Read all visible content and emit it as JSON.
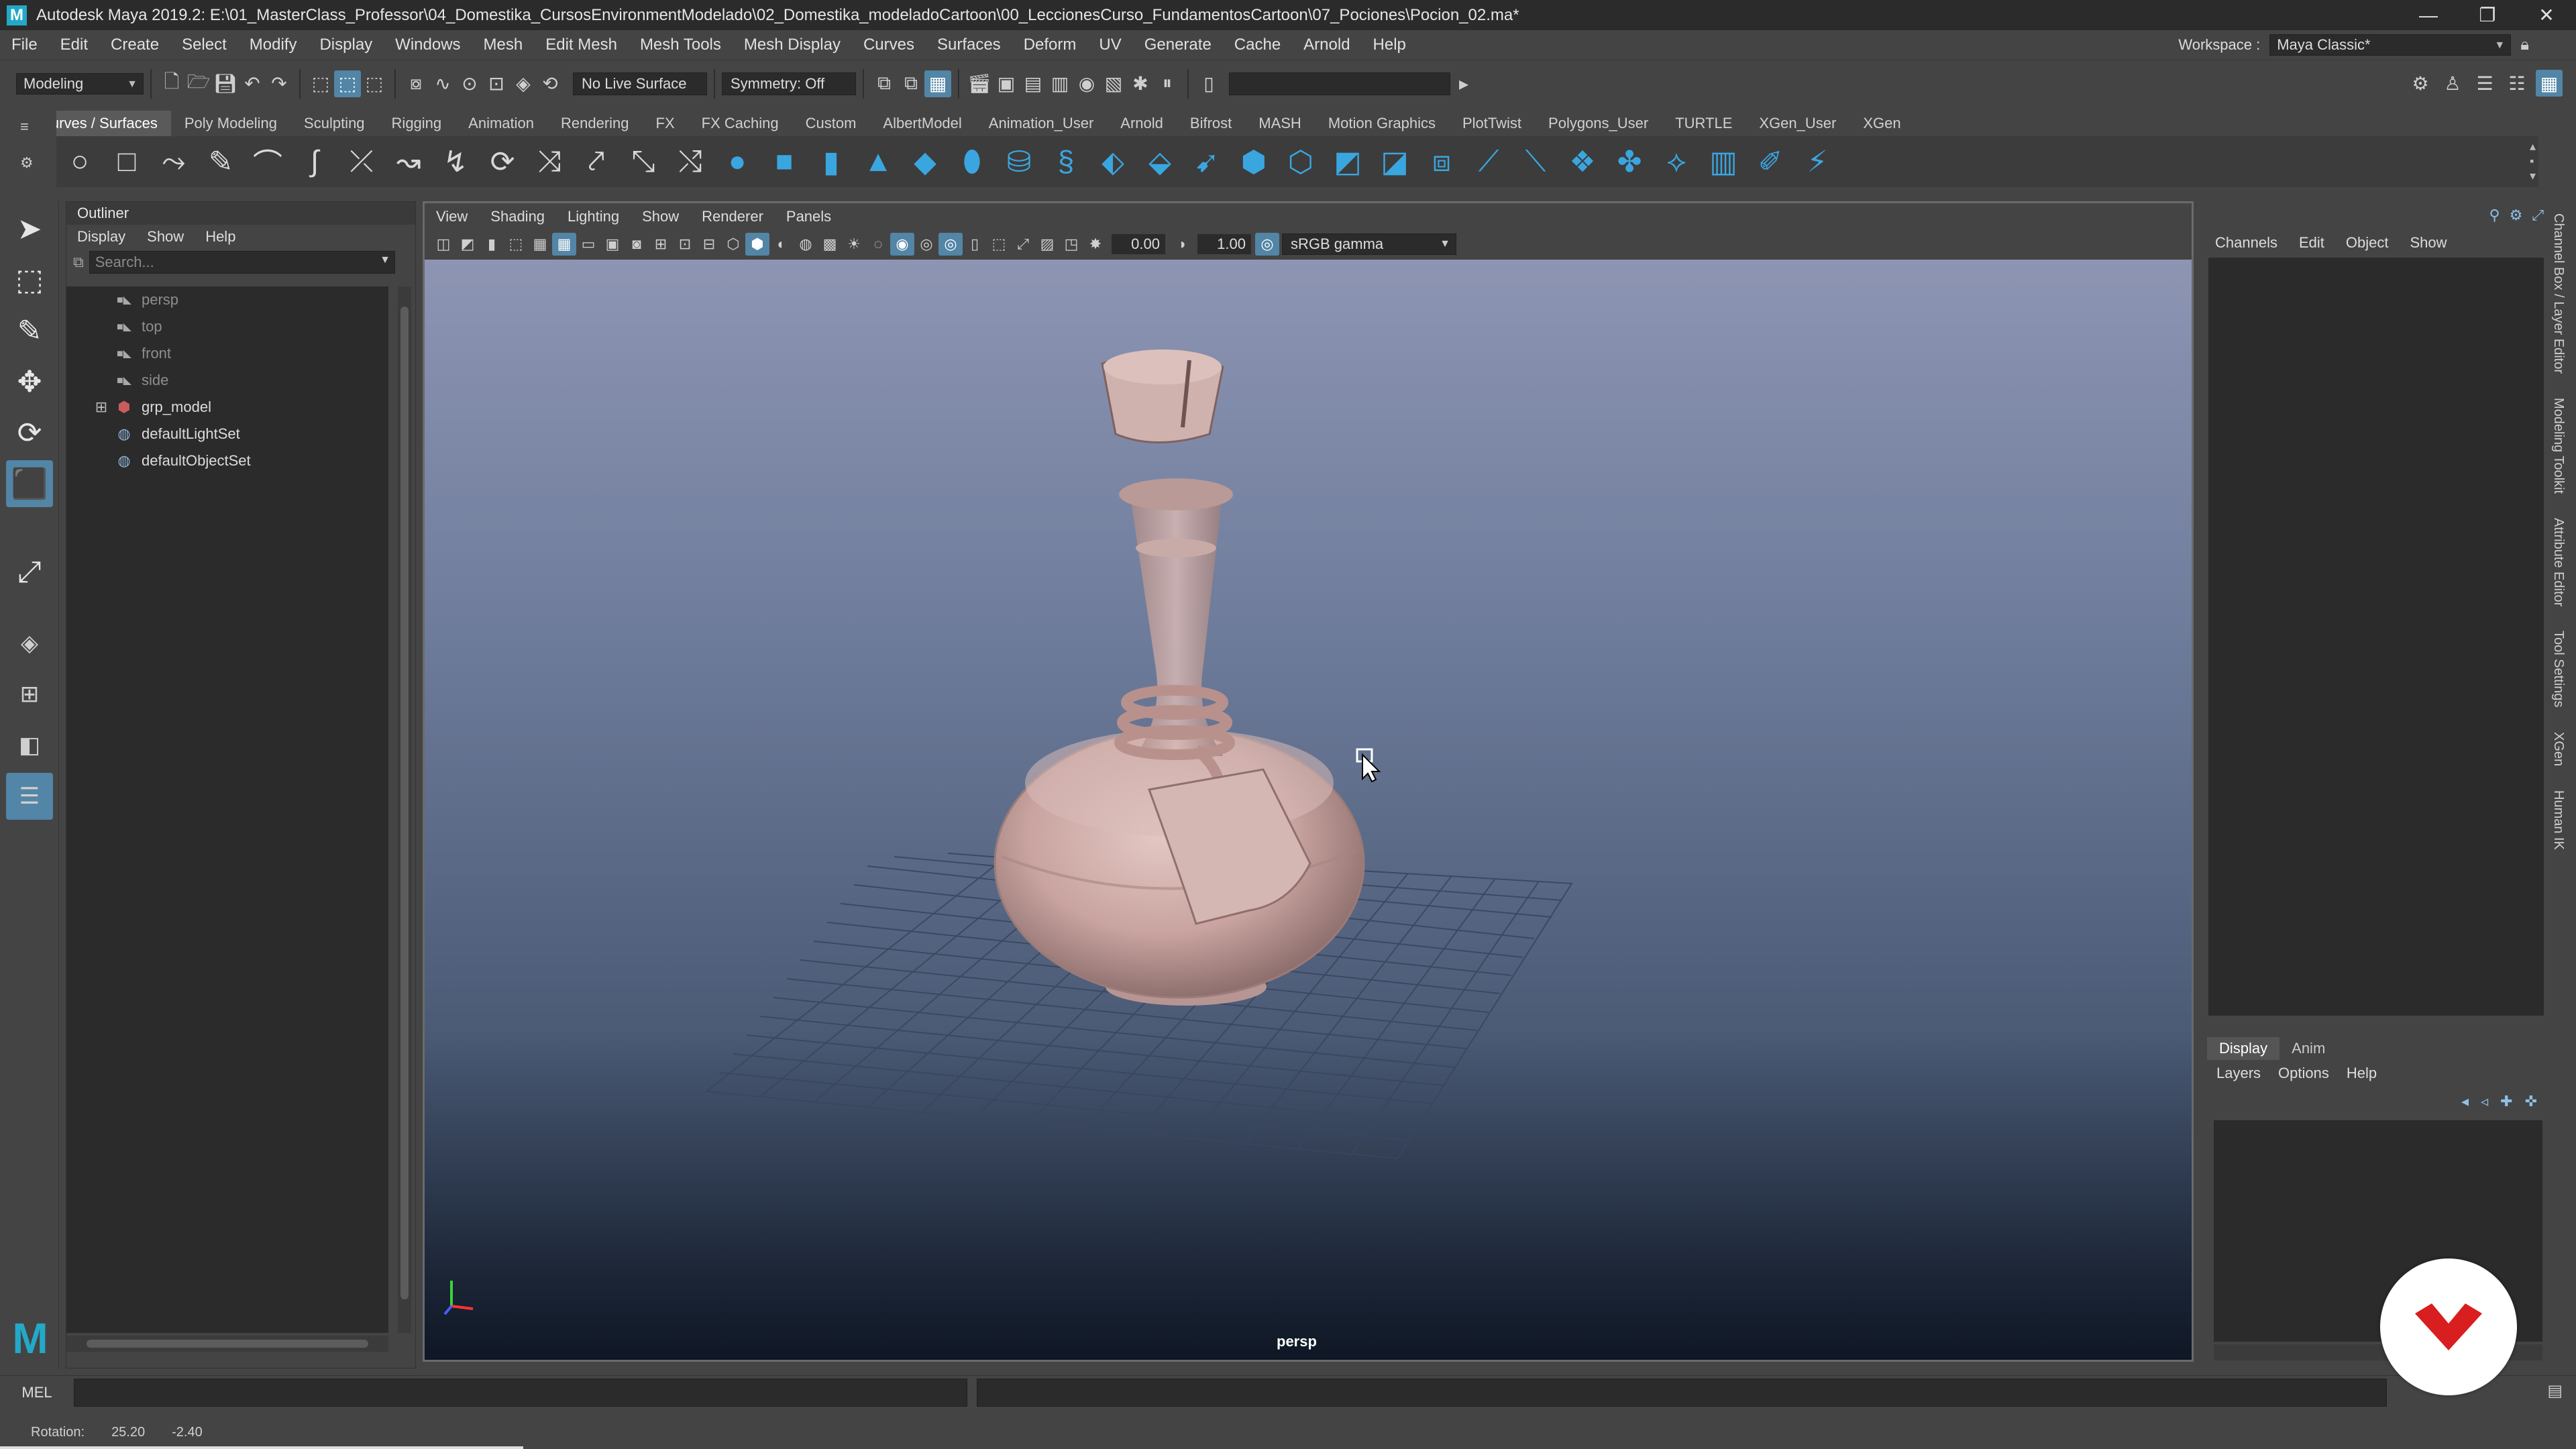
{
  "app": {
    "title": "Autodesk Maya 2019.2: E:\\01_MasterClass_Professor\\04_Domestika_CursosEnvironmentModelado\\02_Domestika_modeladoCartoon\\00_LeccionesCurso_FundamentosCartoon\\07_Pociones\\Pocion_02.ma*",
    "logo_letter": "M",
    "minimize": "—",
    "restore": "❐",
    "close": "✕"
  },
  "menubar": {
    "items": [
      "File",
      "Edit",
      "Create",
      "Select",
      "Modify",
      "Display",
      "Windows",
      "Mesh",
      "Edit Mesh",
      "Mesh Tools",
      "Mesh Display",
      "Curves",
      "Surfaces",
      "Deform",
      "UV",
      "Generate",
      "Cache",
      "Arnold",
      "Help"
    ],
    "workspace_label": "Workspace :",
    "workspace_value": "Maya Classic*"
  },
  "statusline": {
    "menuset": "Modeling",
    "live_surface": "No Live Surface",
    "symmetry": "Symmetry: Off"
  },
  "shelf": {
    "tabs": [
      "Curves / Surfaces",
      "Poly Modeling",
      "Sculpting",
      "Rigging",
      "Animation",
      "Rendering",
      "FX",
      "FX Caching",
      "Custom",
      "AlbertModel",
      "Animation_User",
      "Arnold",
      "Bifrost",
      "MASH",
      "Motion Graphics",
      "PlotTwist",
      "Polygons_User",
      "TURTLE",
      "XGen_User",
      "XGen"
    ],
    "active_tab": "Curves / Surfaces"
  },
  "outliner": {
    "title": "Outliner",
    "menu": [
      "Display",
      "Show",
      "Help"
    ],
    "search_placeholder": "Search...",
    "items": [
      {
        "label": "persp",
        "icon": "camera-icon",
        "dim": true,
        "expandable": false
      },
      {
        "label": "top",
        "icon": "camera-icon",
        "dim": true,
        "expandable": false
      },
      {
        "label": "front",
        "icon": "camera-icon",
        "dim": true,
        "expandable": false
      },
      {
        "label": "side",
        "icon": "camera-icon",
        "dim": true,
        "expandable": false
      },
      {
        "label": "grp_model",
        "icon": "group-icon",
        "dim": false,
        "expandable": true
      },
      {
        "label": "defaultLightSet",
        "icon": "set-icon",
        "dim": false,
        "expandable": false
      },
      {
        "label": "defaultObjectSet",
        "icon": "set-icon",
        "dim": false,
        "expandable": false
      }
    ]
  },
  "viewport": {
    "menu": [
      "View",
      "Shading",
      "Lighting",
      "Show",
      "Renderer",
      "Panels"
    ],
    "exposure": "0.00",
    "gamma": "1.00",
    "color_space": "sRGB gamma",
    "camera_label": "persp"
  },
  "channelbox": {
    "menu": [
      "Channels",
      "Edit",
      "Object",
      "Show"
    ],
    "side_tabs": [
      "Channel Box / Layer Editor",
      "Modeling Toolkit",
      "Attribute Editor",
      "Tool Settings",
      "XGen",
      "Human IK"
    ]
  },
  "layers": {
    "tabs": [
      "Display",
      "Anim"
    ],
    "menu": [
      "Layers",
      "Options",
      "Help"
    ]
  },
  "commandline": {
    "mel_label": "MEL"
  },
  "helpline": {
    "label": "Rotation:",
    "x": "25.20",
    "y": "-2.40"
  },
  "colors": {
    "accent": "#5285a6",
    "badge": "#d81e1e",
    "model": "#c9a4a0"
  }
}
